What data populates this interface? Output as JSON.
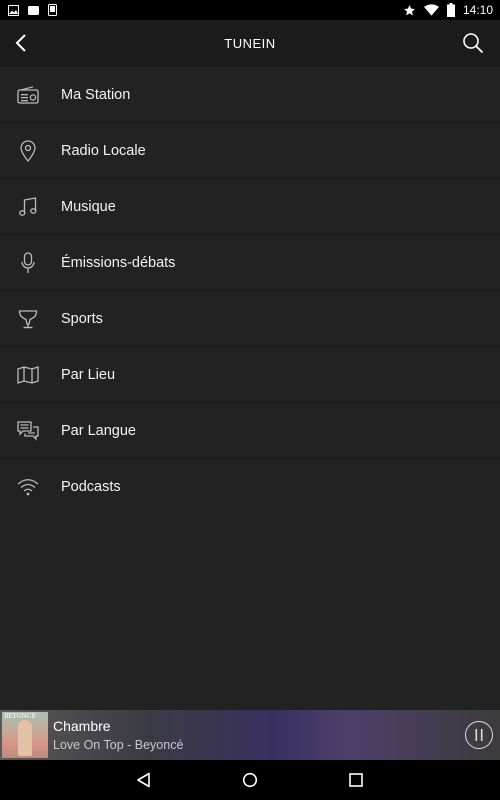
{
  "status_bar": {
    "time": "14:10",
    "left_icons": [
      "image-icon",
      "notification-icon",
      "phone-icon"
    ],
    "right_icons": [
      "star-icon",
      "wifi-icon",
      "battery-icon"
    ]
  },
  "app_bar": {
    "title": "TUNEIN",
    "back_icon": "chevron-left-icon",
    "search_icon": "search-icon"
  },
  "menu": {
    "items": [
      {
        "label": "Ma Station",
        "icon": "radio-icon"
      },
      {
        "label": "Radio Locale",
        "icon": "location-pin-icon"
      },
      {
        "label": "Musique",
        "icon": "music-note-icon"
      },
      {
        "label": "Émissions-débats",
        "icon": "microphone-icon"
      },
      {
        "label": "Sports",
        "icon": "trophy-icon"
      },
      {
        "label": "Par Lieu",
        "icon": "map-icon"
      },
      {
        "label": "Par Langue",
        "icon": "chat-bubbles-icon"
      },
      {
        "label": "Podcasts",
        "icon": "podcast-wifi-icon"
      }
    ]
  },
  "now_playing": {
    "title": "Chambre",
    "subtitle": "Love On Top - Beyoncé",
    "album_art_text": "BEYONCÉ",
    "state": "playing",
    "control_icon": "pause-icon"
  },
  "nav_bar": {
    "icons": [
      "back-triangle-icon",
      "home-circle-icon",
      "recents-square-icon"
    ]
  },
  "colors": {
    "background": "#222222",
    "app_bar": "#1b1b1b",
    "text": "#f2f2f2",
    "icon": "#bbbbbb",
    "divider": "#1a1a1a"
  }
}
